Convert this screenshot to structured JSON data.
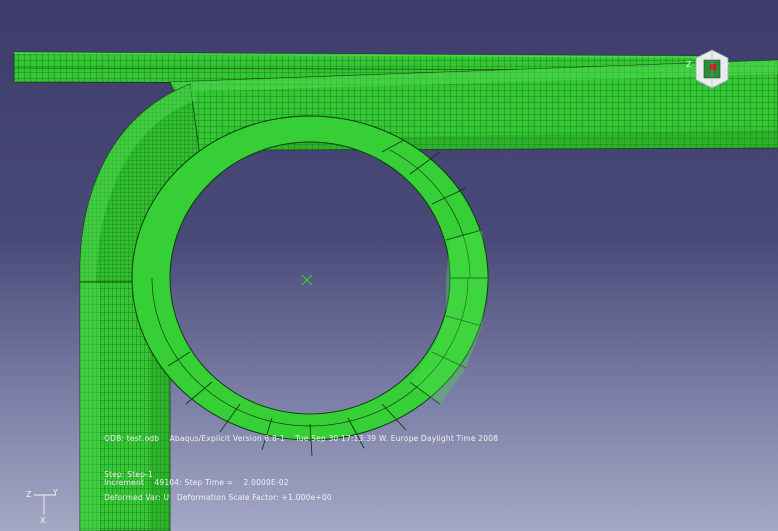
{
  "viewport": {
    "background_top": "#3d3c6c",
    "background_bottom": "#a4a8c4",
    "mesh_fill": "#33c733",
    "mesh_fill_light": "#5be25b",
    "mesh_fill_dark": "#26a826",
    "mesh_line": "#0d3d0d"
  },
  "info": {
    "odb_line": "ODB: test.odb    Abaqus/Explicit Version 6.8-1    Tue Sep 30 17:13:39 W. Europe Daylight Time 2008",
    "step_line": "Step: Step-1",
    "increment_line": "Increment    49104: Step Time =    2.0000E-02",
    "deformed_line": "Deformed Var: U   Deformation Scale Factor: +1.000e+00"
  },
  "triad": {
    "x_label": "X",
    "y_label": "Y",
    "z_label": "Z"
  },
  "view_cube": {
    "icon": "view-cube-icon",
    "x_label": "Z",
    "y_label": "Y"
  },
  "rotation_center": {
    "icon": "rotation-center-icon"
  }
}
